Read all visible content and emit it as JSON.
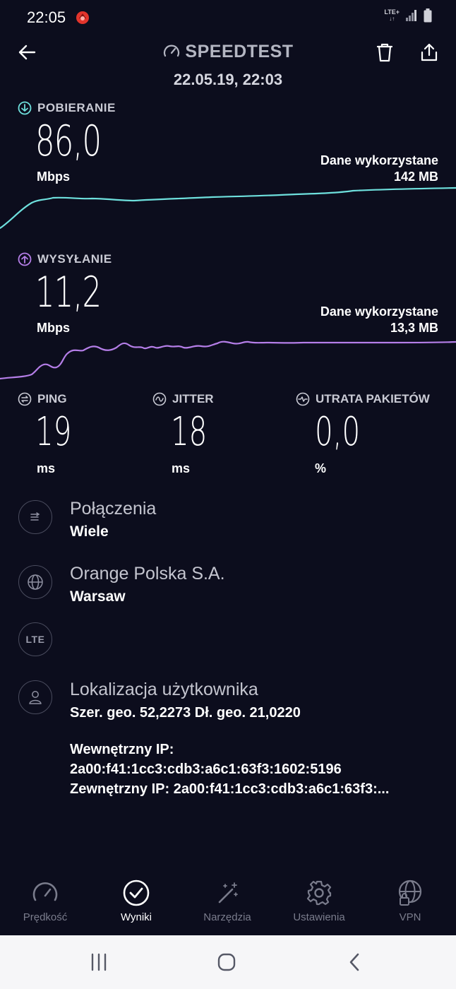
{
  "status": {
    "time": "22:05",
    "network": "LTE+"
  },
  "header": {
    "title": "SPEEDTEST",
    "date": "22.05.19, 22:03"
  },
  "download": {
    "label": "POBIERANIE",
    "value": "86,0",
    "unit": "Mbps",
    "used_label": "Dane wykorzystane",
    "used_value": "142 MB",
    "color": "#6ee0dd"
  },
  "upload": {
    "label": "WYSYŁANIE",
    "value": "11,2",
    "unit": "Mbps",
    "used_label": "Dane wykorzystane",
    "used_value": "13,3 MB",
    "color": "#b57ee8"
  },
  "metrics": [
    {
      "label": "PING",
      "value": "19",
      "unit": "ms"
    },
    {
      "label": "JITTER",
      "value": "18",
      "unit": "ms"
    },
    {
      "label": "UTRATA PAKIETÓW",
      "value": "0,0",
      "unit": "%"
    }
  ],
  "connections": {
    "title": "Połączenia",
    "value": "Wiele"
  },
  "provider": {
    "title": "Orange Polska S.A.",
    "value": "Warsaw"
  },
  "network_type": {
    "badge": "LTE"
  },
  "location": {
    "title": "Lokalizacja użytkownika",
    "coords": "Szer. geo. 52,2273 Dł. geo. 21,0220",
    "internal_ip_label": "Wewnętrzny IP:",
    "internal_ip": "2a00:f41:1cc3:cdb3:a6c1:63f3:1602:5196",
    "external_ip": "Zewnętrzny IP: 2a00:f41:1cc3:cdb3:a6c1:63f3:..."
  },
  "nav": [
    {
      "label": "Prędkość",
      "icon": "speedometer-icon"
    },
    {
      "label": "Wyniki",
      "icon": "check-circle-icon",
      "active": true
    },
    {
      "label": "Narzędzia",
      "icon": "magic-wand-icon"
    },
    {
      "label": "Ustawienia",
      "icon": "gear-icon"
    },
    {
      "label": "VPN",
      "icon": "vpn-globe-lock-icon"
    }
  ]
}
